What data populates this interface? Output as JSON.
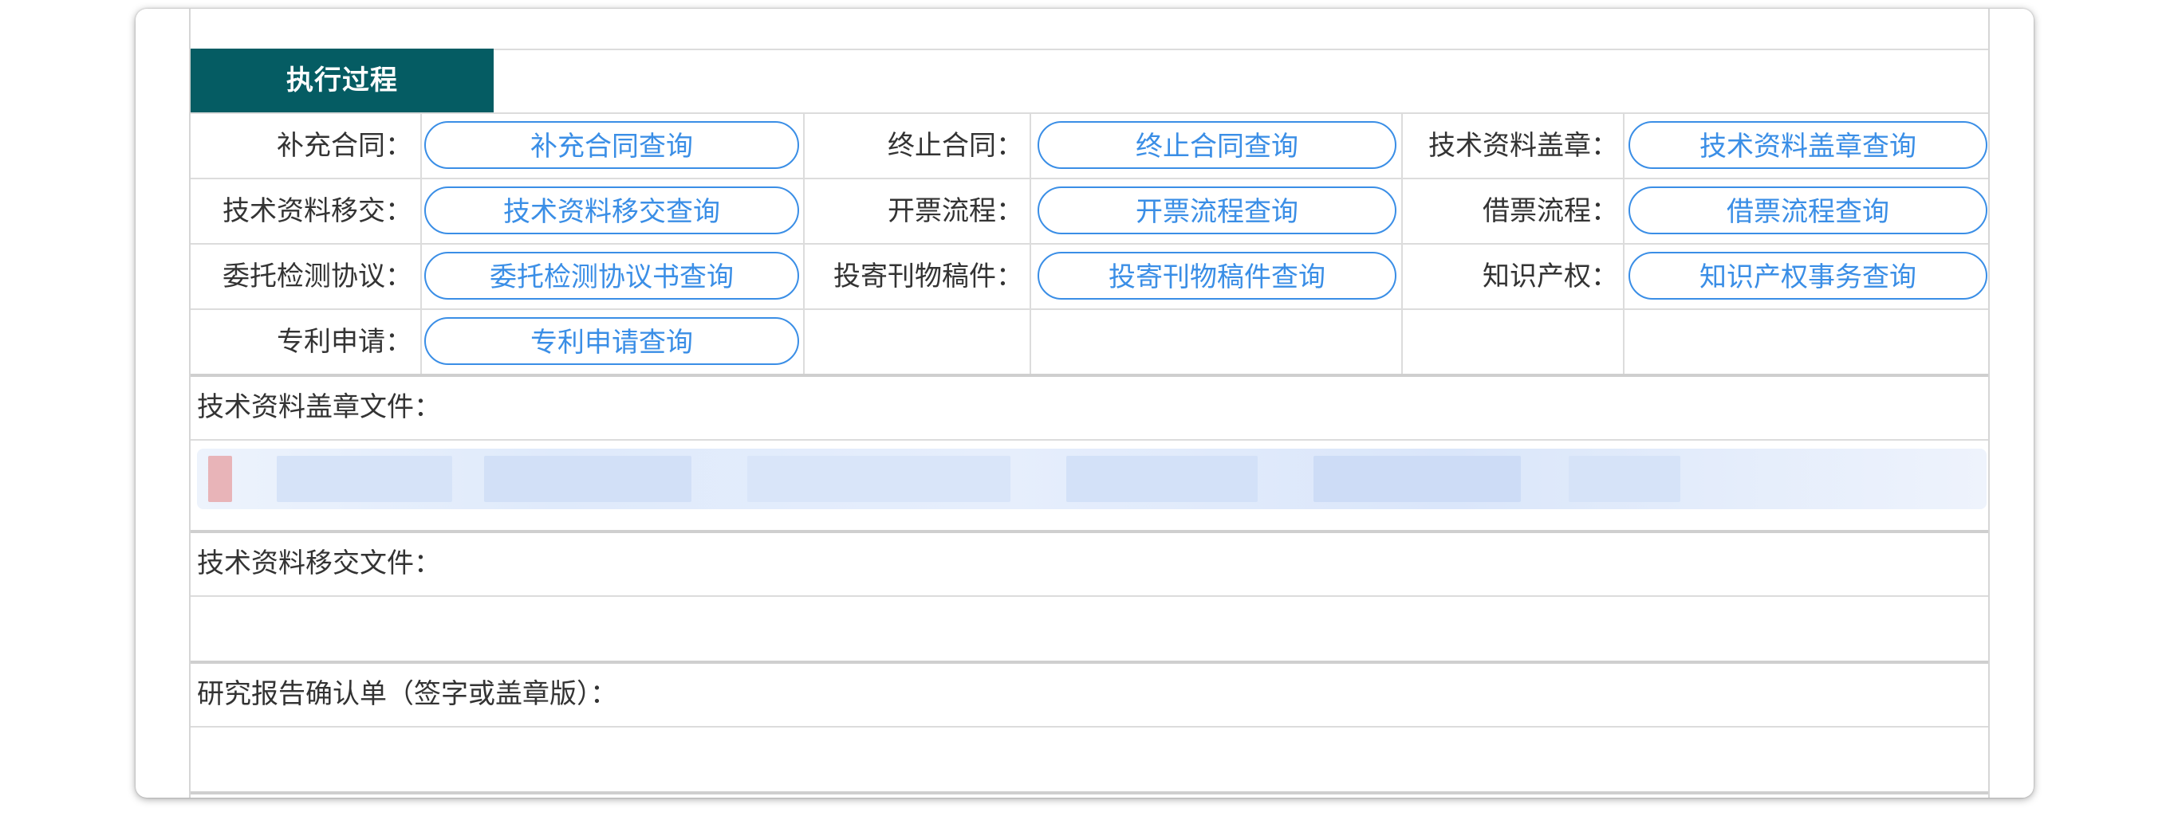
{
  "section_title": "执行过程",
  "rows": [
    {
      "cells": [
        {
          "label": "补充合同：",
          "button": "补充合同查询"
        },
        {
          "label": "终止合同：",
          "button": "终止合同查询"
        },
        {
          "label": "技术资料盖章：",
          "button": "技术资料盖章查询"
        }
      ]
    },
    {
      "cells": [
        {
          "label": "技术资料移交：",
          "button": "技术资料移交查询"
        },
        {
          "label": "开票流程：",
          "button": "开票流程查询"
        },
        {
          "label": "借票流程：",
          "button": "借票流程查询"
        }
      ]
    },
    {
      "cells": [
        {
          "label": "委托检测协议：",
          "button": "委托检测协议书查询"
        },
        {
          "label": "投寄刊物稿件：",
          "button": "投寄刊物稿件查询"
        },
        {
          "label": "知识产权：",
          "button": "知识产权事务查询"
        }
      ]
    },
    {
      "cells": [
        {
          "label": "专利申请：",
          "button": "专利申请查询"
        }
      ]
    }
  ],
  "files": {
    "stamp_label": "技术资料盖章文件：",
    "transfer_label": "技术资料移交文件：",
    "report_label": "研究报告确认单（签字或盖章版）："
  },
  "colors": {
    "header_bg": "#055c63",
    "button_accent": "#3a8ee6",
    "border": "#dcdcdc"
  }
}
